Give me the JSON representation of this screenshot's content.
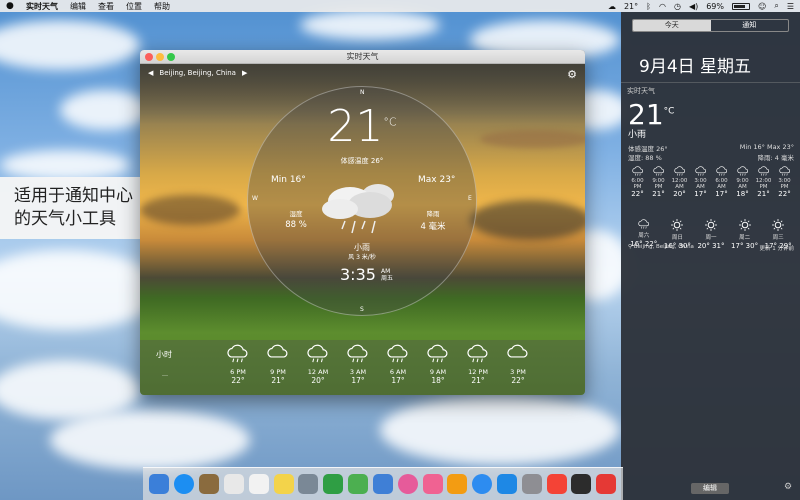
{
  "menubar": {
    "app_name": "实时天气",
    "menus": [
      "编辑",
      "查看",
      "位置",
      "帮助"
    ],
    "temp": "21°",
    "battery": "69%",
    "accent": "#ececec"
  },
  "caption": {
    "line1": "适用于通知中心",
    "line2": "的天气小工具"
  },
  "window": {
    "title": "实时天气",
    "location": "Beijing, Beijing, China",
    "compass": {
      "n": "N",
      "s": "S",
      "e": "E",
      "w": "W"
    },
    "temperature": "21",
    "unit": "°C",
    "feels_like": "体感温度 26°",
    "min": "Min 16°",
    "max": "Max 23°",
    "humidity_label": "湿度",
    "humidity_value": "88 %",
    "precip_label": "降雨",
    "precip_value": "4 毫米",
    "condition": "小雨",
    "wind": "风 3 米/秒",
    "time": "3:35",
    "ampm": "AM",
    "weekday": "周五",
    "hourly_label": "小时",
    "hourly_sub": "…",
    "hourly": [
      {
        "time": "6 PM",
        "temp": "22°",
        "icon": "rain-icon"
      },
      {
        "time": "9 PM",
        "temp": "21°",
        "icon": "cloud-icon"
      },
      {
        "time": "12 AM",
        "temp": "20°",
        "icon": "rain-icon"
      },
      {
        "time": "3 AM",
        "temp": "17°",
        "icon": "rain-icon"
      },
      {
        "time": "6 AM",
        "temp": "17°",
        "icon": "rain-icon"
      },
      {
        "time": "9 AM",
        "temp": "18°",
        "icon": "rain-icon"
      },
      {
        "time": "12 PM",
        "temp": "21°",
        "icon": "rain-icon"
      },
      {
        "time": "3 PM",
        "temp": "22°",
        "icon": "cloud-icon"
      }
    ]
  },
  "notification_center": {
    "tab_today": "今天",
    "tab_notifications": "通知",
    "date": "9月4日 星期五",
    "widget_title": "实时天气",
    "temperature": "21",
    "unit": "°C",
    "condition": "小雨",
    "feels": "体感温度 26°",
    "humidity": "湿度: 88 %",
    "minmax": "Min 16° Max 23°",
    "precip": "降雨: 4 毫米",
    "hourly": [
      {
        "time": "6:00 PM",
        "temp": "22°"
      },
      {
        "time": "9:00 PM",
        "temp": "21°"
      },
      {
        "time": "12:00 AM",
        "temp": "20°"
      },
      {
        "time": "3:00 AM",
        "temp": "17°"
      },
      {
        "time": "6:00 AM",
        "temp": "17°"
      },
      {
        "time": "9:00 AM",
        "temp": "18°"
      },
      {
        "time": "12:00 PM",
        "temp": "21°"
      },
      {
        "time": "3:00 PM",
        "temp": "22°"
      }
    ],
    "daily": [
      {
        "day": "周六",
        "temps": "16°  22°"
      },
      {
        "day": "周日",
        "temps": "16°  30°"
      },
      {
        "day": "周一",
        "temps": "20°  31°"
      },
      {
        "day": "周二",
        "temps": "17°  30°"
      },
      {
        "day": "周三",
        "temps": "17°  29°"
      }
    ],
    "footer_location": "Beijing, Beijing, China",
    "footer_updated": "更新 1 分钟前",
    "edit_label": "编辑"
  },
  "dock": {
    "colors": [
      "#3b7fd9",
      "#1c8ef2",
      "#8a6b3e",
      "#e8e8e8",
      "#f2f2f2",
      "#f3d34a",
      "#7a8896",
      "#2f9e44",
      "#4caf50",
      "#3f7fd6",
      "#e65b9a",
      "#f06292",
      "#f39c12",
      "#2d8cf0",
      "#1e88e5",
      "#8e8e93",
      "#f44336",
      "#2c2c2c",
      "#e53935"
    ]
  }
}
